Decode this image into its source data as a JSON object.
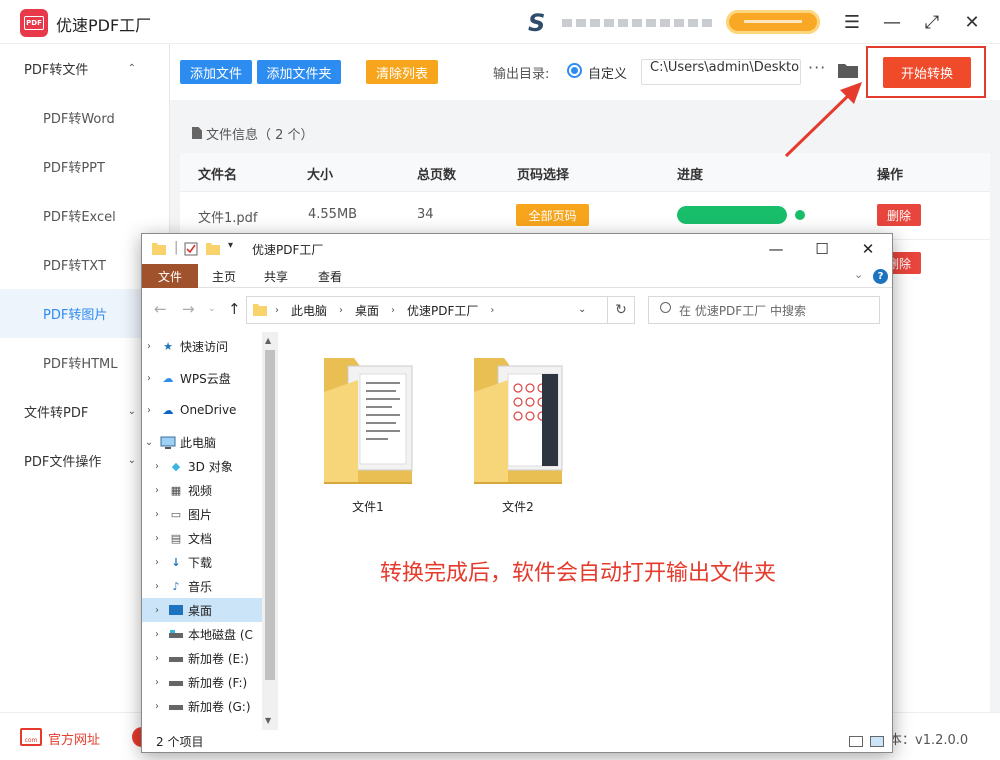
{
  "app": {
    "title": "优速PDF工厂",
    "logo_text": "PDF"
  },
  "window_controls": {
    "menu": "☰",
    "minimize": "—",
    "maximize": "⤢",
    "close": "✕"
  },
  "sidebar": {
    "groups": [
      {
        "label": "PDF转文件",
        "chevron": "⌃"
      },
      {
        "label": "文件转PDF",
        "chevron": "⌄"
      },
      {
        "label": "PDF文件操作",
        "chevron": "⌄"
      }
    ],
    "items": [
      {
        "label": "PDF转Word"
      },
      {
        "label": "PDF转PPT"
      },
      {
        "label": "PDF转Excel"
      },
      {
        "label": "PDF转TXT"
      },
      {
        "label": "PDF转图片"
      },
      {
        "label": "PDF转HTML"
      }
    ]
  },
  "toolbar": {
    "add_file": "添加文件",
    "add_folder": "添加文件夹",
    "clear_list": "清除列表",
    "output_dir_label": "输出目录:",
    "custom_label": "自定义",
    "path_value": "C:\\Users\\admin\\Deskto",
    "more": "···",
    "start": "开始转换"
  },
  "file_panel": {
    "header": "文件信息（ 2 个）",
    "columns": [
      "文件名",
      "大小",
      "总页数",
      "页码选择",
      "进度",
      "操作"
    ],
    "rows": [
      {
        "name": "文件1.pdf",
        "size": "4.55MB",
        "pages": "34",
        "page_select": "全部页码",
        "progress": 1.0,
        "action": "删除"
      },
      {
        "action": "删除"
      }
    ]
  },
  "explorer": {
    "title": "优速PDF工厂",
    "ribbon_tabs": [
      "文件",
      "主页",
      "共享",
      "查看"
    ],
    "help": "?",
    "breadcrumb": [
      "此电脑",
      "桌面",
      "优速PDF工厂"
    ],
    "search_placeholder": "在 优速PDF工厂 中搜索",
    "tree": [
      {
        "label": "快速访问",
        "icon": "star-icon"
      },
      {
        "label": "WPS云盘",
        "icon": "cloud-icon"
      },
      {
        "label": "OneDrive",
        "icon": "cloud-icon"
      },
      {
        "label": "此电脑",
        "icon": "computer-icon"
      },
      {
        "label": "3D 对象",
        "icon": "cube-icon"
      },
      {
        "label": "视频",
        "icon": "video-icon"
      },
      {
        "label": "图片",
        "icon": "image-icon"
      },
      {
        "label": "文档",
        "icon": "document-icon"
      },
      {
        "label": "下载",
        "icon": "download-icon"
      },
      {
        "label": "音乐",
        "icon": "music-icon"
      },
      {
        "label": "桌面",
        "icon": "desktop-icon"
      },
      {
        "label": "本地磁盘 (C",
        "icon": "drive-icon"
      },
      {
        "label": "新加卷 (E:)",
        "icon": "drive-icon"
      },
      {
        "label": "新加卷 (F:)",
        "icon": "drive-icon"
      },
      {
        "label": "新加卷 (G:)",
        "icon": "drive-icon"
      }
    ],
    "folders": [
      {
        "label": "文件1"
      },
      {
        "label": "文件2"
      }
    ],
    "status": "2 个项目"
  },
  "annotation": "转换完成后，软件会自动打开输出文件夹",
  "footer": {
    "website": "官方网址",
    "version": "版本：v1.2.0.0"
  },
  "colors": {
    "primary_blue": "#2d8cf0",
    "orange": "#f7a51c",
    "red": "#e53b2c",
    "green": "#19be6b"
  }
}
